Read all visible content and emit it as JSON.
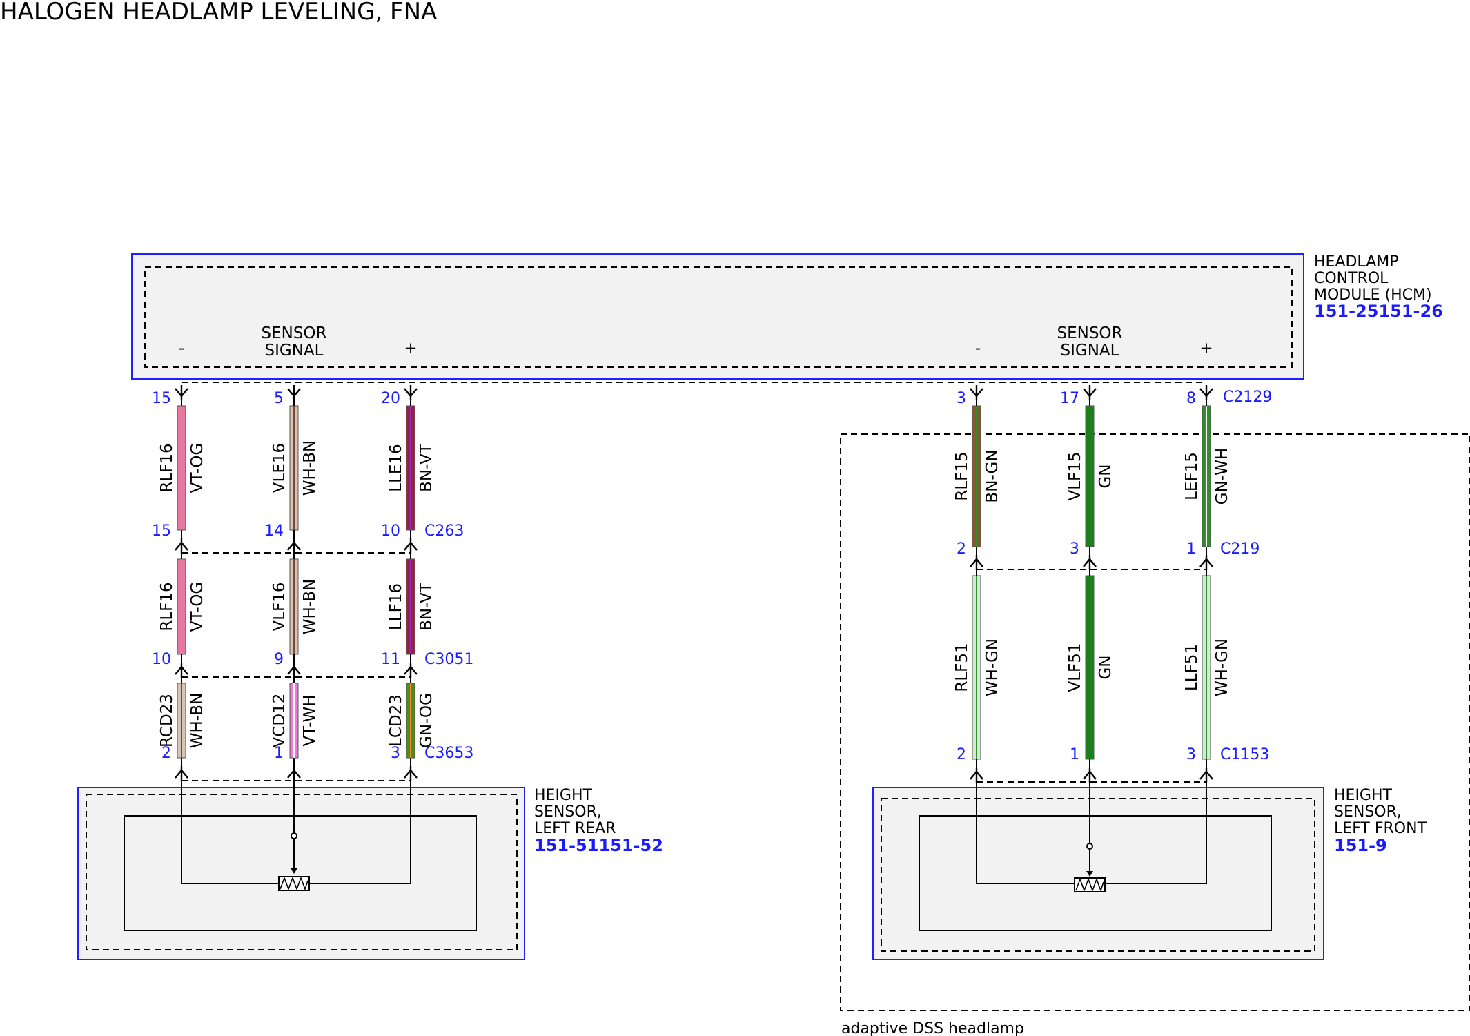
{
  "title": "HALOGEN HEADLAMP LEVELING, FNA",
  "colors": {
    "VT-OG": "#e8779f",
    "WH-BN": "#d9c5b8",
    "BN-VT": "#a01f3f",
    "GN-OG": "#4f8d1c",
    "VT-WH": "#ee79d9",
    "BN-GN": "#8a5a2e",
    "GN": "#1e7d1e",
    "GN-WH": "#2f8f2f",
    "WH-GN": "#d5ead2",
    "module_border": "#2020ff",
    "module_fill": "#f2f2f2"
  },
  "hcm": {
    "name_lines": [
      "HEADLAMP",
      "CONTROL",
      "MODULE (HCM)"
    ],
    "ref": "151-25151-26",
    "left_pins": {
      "minus": "-",
      "sensor": [
        "SENSOR",
        "SIGNAL"
      ],
      "plus": "+"
    },
    "right_pins": {
      "minus": "-",
      "sensor": [
        "SENSOR",
        "SIGNAL"
      ],
      "plus": "+"
    },
    "right_connector": "C2129"
  },
  "rear_sensor": {
    "name_lines": [
      "HEIGHT",
      "SENSOR,",
      "LEFT REAR"
    ],
    "ref": "151-51151-52"
  },
  "front_sensor": {
    "name_lines": [
      "HEIGHT",
      "SENSOR,",
      "LEFT FRONT"
    ],
    "ref": "151-9"
  },
  "adaptive_label": "adaptive DSS headlamp",
  "rear_segments": [
    {
      "connector_bottom": "C263",
      "wires": [
        {
          "circuit": "RLF16",
          "color": "VT-OG",
          "pin_top": "15",
          "pin_bottom": "15"
        },
        {
          "circuit": "VLE16",
          "color": "WH-BN",
          "pin_top": "5",
          "pin_bottom": "14"
        },
        {
          "circuit": "LLE16",
          "color": "BN-VT",
          "pin_top": "20",
          "pin_bottom": "10"
        }
      ]
    },
    {
      "connector_bottom": "C3051",
      "wires": [
        {
          "circuit": "RLF16",
          "color": "VT-OG",
          "pin_bottom": "10"
        },
        {
          "circuit": "VLF16",
          "color": "WH-BN",
          "pin_bottom": "9"
        },
        {
          "circuit": "LLF16",
          "color": "BN-VT",
          "pin_bottom": "11"
        }
      ]
    },
    {
      "connector_bottom": "C3653",
      "wires": [
        {
          "circuit": "RCD23",
          "color": "WH-BN",
          "pin_bottom": "2"
        },
        {
          "circuit": "VCD12",
          "color": "VT-WH",
          "pin_bottom": "1"
        },
        {
          "circuit": "LCD23",
          "color": "GN-OG",
          "pin_bottom": "3"
        }
      ]
    }
  ],
  "front_segments": [
    {
      "connector_bottom": "C219",
      "wires": [
        {
          "circuit": "RLF15",
          "color": "BN-GN",
          "pin_top": "3",
          "pin_bottom": "2"
        },
        {
          "circuit": "VLF15",
          "color": "GN",
          "pin_top": "17",
          "pin_bottom": "3"
        },
        {
          "circuit": "LEF15",
          "color": "GN-WH",
          "pin_top": "8",
          "pin_bottom": "1"
        }
      ]
    },
    {
      "connector_bottom": "C1153",
      "wires": [
        {
          "circuit": "RLF51",
          "color": "WH-GN",
          "pin_bottom": "2"
        },
        {
          "circuit": "VLF51",
          "color": "GN",
          "pin_bottom": "1"
        },
        {
          "circuit": "LLF51",
          "color": "WH-GN",
          "pin_bottom": "3"
        }
      ]
    }
  ]
}
